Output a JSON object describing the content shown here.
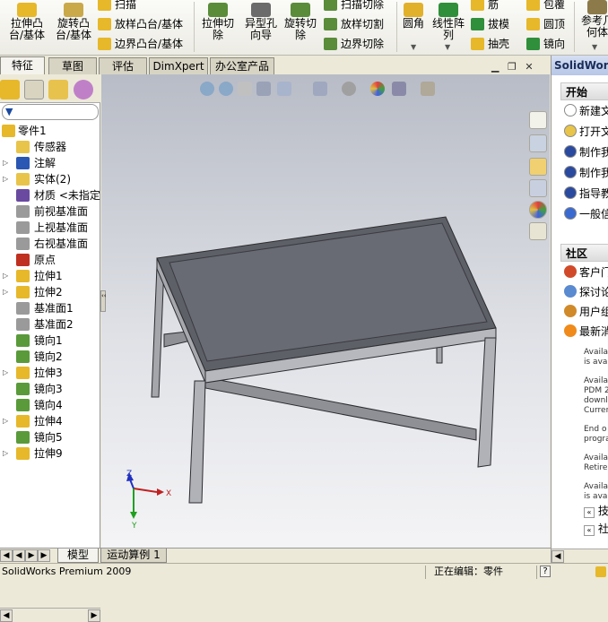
{
  "ribbon": {
    "buttons": [
      {
        "label": "拉伸凸\n台/基体",
        "color": "#e6b82a"
      },
      {
        "label": "旋转凸\n台/基体",
        "color": "#c9a94a"
      },
      {
        "label": "拉伸切\n除",
        "color": "#5a8c3a"
      },
      {
        "label": "异型孔\n向导",
        "color": "#6b6b6b"
      },
      {
        "label": "旋转切\n除",
        "color": "#5a8c3a"
      },
      {
        "label": "圆角",
        "color": "#e2b12b"
      },
      {
        "label": "线性阵\n列",
        "color": "#2f8f3a"
      },
      {
        "label": "参考几\n何体",
        "color": "#8c7a4a"
      }
    ],
    "small": [
      {
        "label": "扫描"
      },
      {
        "label": "放样凸台/基体"
      },
      {
        "label": "边界凸台/基体"
      },
      {
        "label": "扫描切除"
      },
      {
        "label": "放样切割"
      },
      {
        "label": "边界切除"
      },
      {
        "label": "筋"
      },
      {
        "label": "拔模"
      },
      {
        "label": "抽壳"
      },
      {
        "label": "包覆"
      },
      {
        "label": "圆顶"
      },
      {
        "label": "镜向"
      }
    ]
  },
  "tabs": [
    "特征",
    "草图",
    "评估",
    "DimXpert",
    "办公室产品"
  ],
  "tree": {
    "root": "零件1",
    "items": [
      {
        "label": "传感器",
        "expand": "",
        "color": "#e8c44a"
      },
      {
        "label": "注解",
        "expand": "▷",
        "color": "#2a56b4"
      },
      {
        "label": "实体(2)",
        "expand": "▷",
        "color": "#e8c44a"
      },
      {
        "label": "材质 <未指定>",
        "expand": "",
        "color": "#6a4aa0"
      },
      {
        "label": "前视基准面",
        "expand": "",
        "color": "#9a9a9a"
      },
      {
        "label": "上视基准面",
        "expand": "",
        "color": "#9a9a9a"
      },
      {
        "label": "右视基准面",
        "expand": "",
        "color": "#9a9a9a"
      },
      {
        "label": "原点",
        "expand": "",
        "color": "#c03020"
      },
      {
        "label": "拉伸1",
        "expand": "▷",
        "color": "#e6b82a"
      },
      {
        "label": "拉伸2",
        "expand": "▷",
        "color": "#e6b82a"
      },
      {
        "label": "基准面1",
        "expand": "",
        "color": "#9a9a9a"
      },
      {
        "label": "基准面2",
        "expand": "",
        "color": "#9a9a9a"
      },
      {
        "label": "镜向1",
        "expand": "",
        "color": "#5a9a3a"
      },
      {
        "label": "镜向2",
        "expand": "",
        "color": "#5a9a3a"
      },
      {
        "label": "拉伸3",
        "expand": "▷",
        "color": "#e6b82a"
      },
      {
        "label": "镜向3",
        "expand": "",
        "color": "#5a9a3a"
      },
      {
        "label": "镜向4",
        "expand": "",
        "color": "#5a9a3a"
      },
      {
        "label": "拉伸4",
        "expand": "▷",
        "color": "#e6b82a"
      },
      {
        "label": "镜向5",
        "expand": "",
        "color": "#5a9a3a"
      },
      {
        "label": "拉伸9",
        "expand": "▷",
        "color": "#e6b82a"
      }
    ]
  },
  "viewport": {
    "triad": {
      "x": "X",
      "y": "Y",
      "z": "Z"
    }
  },
  "taskpane": {
    "title": "SolidWorks 资源",
    "start_header": "开始",
    "start_items": [
      {
        "label": "新建文档",
        "color": "#ffffff"
      },
      {
        "label": "打开文档",
        "color": "#e8c44a"
      },
      {
        "label": "制作我的第一个零件",
        "color": "#2a4aa0"
      },
      {
        "label": "制作我的第一个装配体",
        "color": "#2a4aa0"
      },
      {
        "label": "指导教程",
        "color": "#2a4aa0"
      },
      {
        "label": "一般信息",
        "color": "#3a6ad0"
      }
    ],
    "community_header": "社区",
    "community_items": [
      {
        "label": "客户门户",
        "color": "#d04a2a"
      },
      {
        "label": "探讨论坛",
        "color": "#5a8ad0"
      },
      {
        "label": "用户组",
        "color": "#d08a2a"
      },
      {
        "label": "最新消息",
        "color": "#f08a1a"
      }
    ],
    "news": [
      [
        "Availa",
        "is ava"
      ],
      [
        "Availa",
        "PDM 2",
        "downlo",
        "Curren"
      ],
      [
        "End o",
        "progra"
      ],
      [
        "Availa",
        "Retire"
      ],
      [
        "Availa",
        "is ava"
      ]
    ],
    "links": [
      {
        "label": "技"
      },
      {
        "label": "社"
      }
    ]
  },
  "bottom_tabs": [
    "模型",
    "运动算例 1"
  ],
  "status": {
    "product": "SolidWorks Premium 2009",
    "editing": "正在编辑：零件",
    "help": "?"
  }
}
